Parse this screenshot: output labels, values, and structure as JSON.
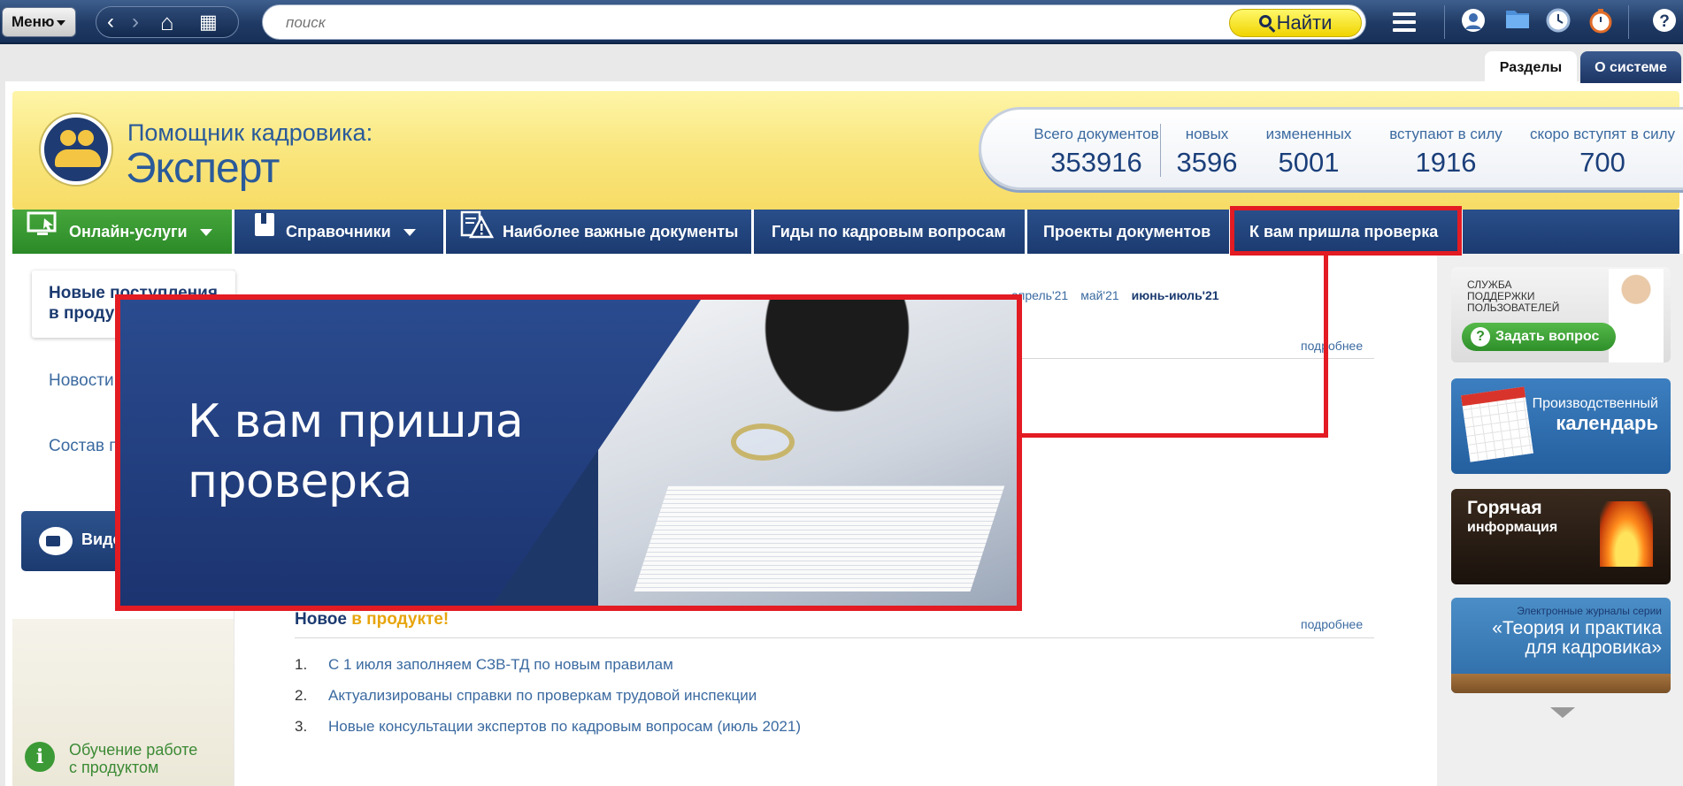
{
  "topbar": {
    "menu_label": "Меню",
    "search_placeholder": "поиск",
    "find_label": "Найти"
  },
  "tabs": {
    "razdely": "Разделы",
    "o_sisteme": "О системе"
  },
  "brand": {
    "subtitle": "Помощник кадровика:",
    "title": "Эксперт"
  },
  "stats": [
    {
      "label": "Всего документов",
      "value": "353916"
    },
    {
      "label": "новых",
      "value": "3596"
    },
    {
      "label": "измененных",
      "value": "5001"
    },
    {
      "label": "вступают в силу",
      "value": "1916"
    },
    {
      "label": "скоро вступят в силу",
      "value": "700"
    }
  ],
  "nav": {
    "online": "Онлайн-услуги",
    "spravochniki": "Справочники",
    "important": "Наиболее важные документы",
    "guides": "Гиды по кадровым вопросам",
    "projects": "Проекты документов",
    "inspection": "К вам пришла проверка"
  },
  "left": {
    "card_title_1": "Новые поступления",
    "card_title_2": "в проду",
    "link_news": "Новости",
    "link_sostav": "Состав п",
    "video_label": "Виде",
    "learn_line1": "Обучение работе",
    "learn_line2": "с продуктом"
  },
  "months": {
    "items": [
      "апрель'21",
      "май'21"
    ],
    "current": "июнь-июль'21"
  },
  "more_label": "подробнее",
  "new_in_product": {
    "part1": "Новое",
    "part2": "в продукте!",
    "items": [
      {
        "n": "1.",
        "text": "С 1 июля заполняем СЗВ-ТД по новым правилам"
      },
      {
        "n": "2.",
        "text": "Актуализированы справки по проверкам трудовой инспекции"
      },
      {
        "n": "3.",
        "text": "Новые консультации экспертов по кадровым вопросам (июль 2021)"
      }
    ]
  },
  "right": {
    "support_line1": "СЛУЖБА",
    "support_line2": "ПОДДЕРЖКИ",
    "support_line3": "ПОЛЬЗОВАТЕЛЕЙ",
    "ask_label": "Задать вопрос",
    "calendar_line1": "Производственный",
    "calendar_line2": "календарь",
    "hot_line1": "Горячая",
    "hot_line2": "информация",
    "journal_line1": "Электронные журналы серии",
    "journal_line2": "«Теория и практика",
    "journal_line3": "для кадровика»"
  },
  "popup": {
    "title_line1": "К вам пришла",
    "title_line2": "проверка"
  },
  "colors": {
    "highlight": "#e31b23",
    "nav_blue": "#1b3a70",
    "online_green": "#2b8a27",
    "banner_yellow": "#f9e67e"
  },
  "icons": [
    "arrow-left-icon",
    "arrow-right-icon",
    "home-icon",
    "grid-icon",
    "search-icon",
    "hamburger-icon",
    "user-icon",
    "folder-icon",
    "clock-icon",
    "stopwatch-icon",
    "help-icon"
  ]
}
